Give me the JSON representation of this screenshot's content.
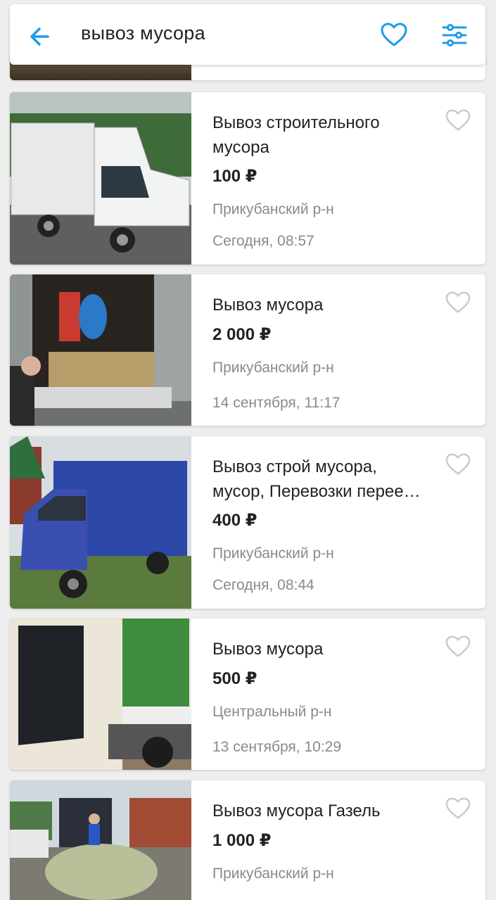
{
  "header": {
    "search_query": "вывоз мусора",
    "back_icon": "arrow-left-icon",
    "favorite_icon": "heart-outline-icon",
    "filter_icon": "filter-sliders-icon",
    "accent_color": "#1e9be8"
  },
  "listings": [
    {
      "title_line1": "Вывоз строительного",
      "title_line2": "мусора",
      "price": "100 ₽",
      "district": "Прикубанский р-н",
      "date": "Сегодня, 08:57"
    },
    {
      "title_line1": "Вывоз мусора",
      "title_line2": "",
      "price": "2 000 ₽",
      "district": "Прикубанский р-н",
      "date": "14 сентября, 11:17"
    },
    {
      "title_line1": "Вывоз строй мусора,",
      "title_line2": "мусор, Перевозки перее…",
      "price": "400 ₽",
      "district": "Прикубанский р-н",
      "date": "Сегодня, 08:44"
    },
    {
      "title_line1": "Вывоз мусора",
      "title_line2": "",
      "price": "500 ₽",
      "district": "Центральный р-н",
      "date": "13 сентября, 10:29"
    },
    {
      "title_line1": "Вывоз мусора Газель",
      "title_line2": "",
      "price": "1 000 ₽",
      "district": "Прикубанский р-н",
      "date": ""
    }
  ]
}
